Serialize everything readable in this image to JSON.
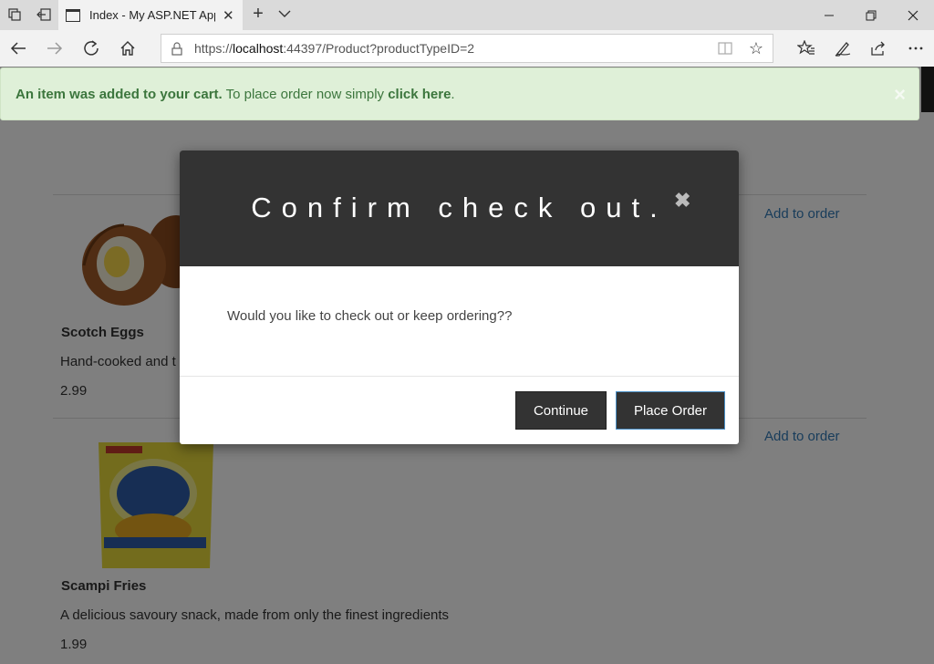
{
  "browser": {
    "tab_title": "Index - My ASP.NET App",
    "url_prefix": "https://",
    "url_host": "localhost",
    "url_rest": ":44397/Product?productTypeID=2"
  },
  "alert": {
    "strong_text": "An item was added to your cart.",
    "text": " To place order now simply ",
    "link_text": "click here",
    "end": "."
  },
  "products": [
    {
      "name": "Scotch Eggs",
      "desc": "Hand-cooked and t",
      "price": "2.99",
      "action": "Add to order"
    },
    {
      "name": "Scampi Fries",
      "desc": "A delicious savoury snack, made from only the finest ingredients",
      "price": "1.99",
      "action": "Add to order"
    }
  ],
  "modal": {
    "title": "Confirm check out.",
    "body": "Would you like to check out or keep ordering??",
    "continue_label": "Continue",
    "place_order_label": "Place Order",
    "close_symbol": "✖"
  },
  "icons": {
    "alert_close": "×"
  }
}
